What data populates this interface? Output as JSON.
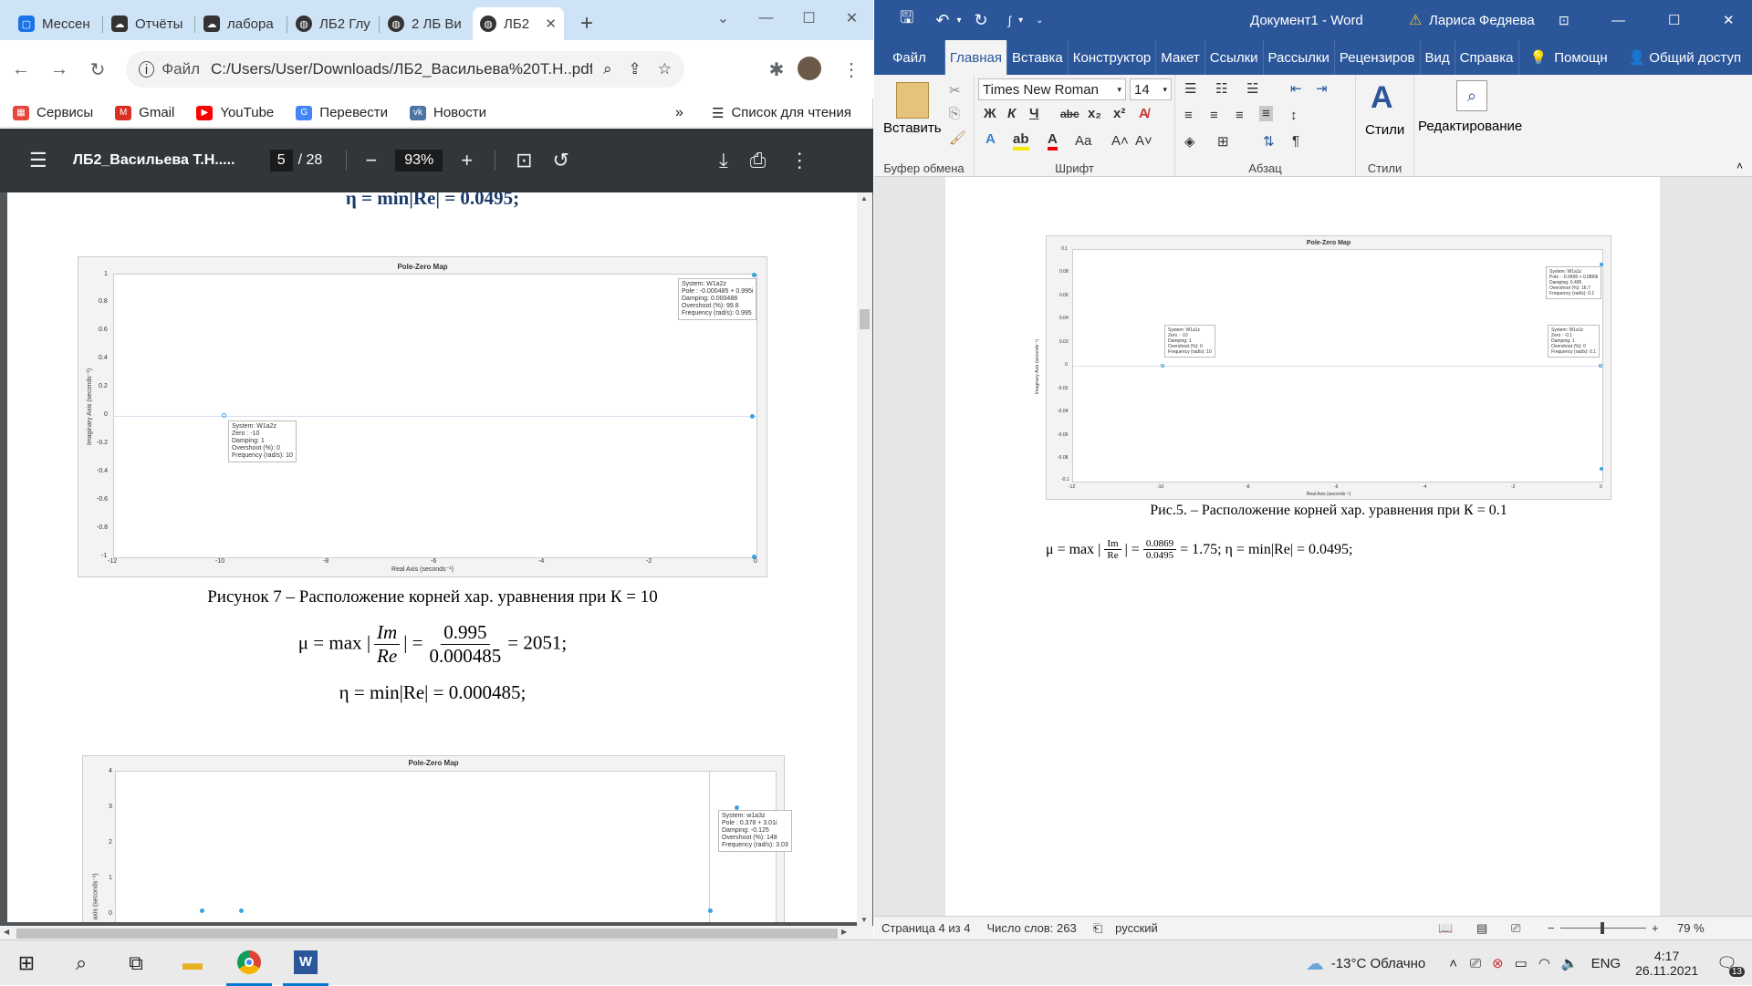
{
  "browser": {
    "tabs": [
      {
        "label": "Мессен",
        "icon": "messenger-icon",
        "color": "#1a73e8"
      },
      {
        "label": "Отчёты",
        "icon": "cloud-icon",
        "color": "#333"
      },
      {
        "label": "лабора",
        "icon": "cloud-icon",
        "color": "#333"
      },
      {
        "label": "ЛБ2 Глу",
        "icon": "globe-icon",
        "color": "#333"
      },
      {
        "label": "2 ЛБ Ви",
        "icon": "globe-icon",
        "color": "#333"
      },
      {
        "label": "ЛБ2",
        "icon": "globe-icon",
        "color": "#333"
      }
    ],
    "new_tab": "+",
    "address_prefix": "Файл",
    "address": "C:/Users/User/Downloads/ЛБ2_Васильева%20Т.Н..pdf",
    "bookmarks": [
      {
        "label": "Сервисы",
        "icon": "apps-icon",
        "color": "#e8453c"
      },
      {
        "label": "Gmail",
        "icon": "gmail-icon",
        "color": "#d93025"
      },
      {
        "label": "YouTube",
        "icon": "youtube-icon",
        "color": "#ff0000"
      },
      {
        "label": "Перевести",
        "icon": "translate-icon",
        "color": "#4285f4"
      },
      {
        "label": "Новости",
        "icon": "vk-icon",
        "color": "#4c75a3"
      }
    ],
    "bookmarks_more": "»",
    "reading_list": "Список для чтения"
  },
  "pdf": {
    "title": "ЛБ2_Васильева Т.Н.....",
    "page": "5",
    "page_total": "/ 28",
    "zoom": "93%",
    "eta_top": "η = min|Re| = 0.0495;",
    "plot1": {
      "title": "Pole-Zero Map",
      "xlabel": "Real Axis (seconds⁻¹)",
      "ylabel": "Imaginary Axis (seconds⁻¹)",
      "yticks": [
        "1",
        "0.8",
        "0.6",
        "0.4",
        "0.2",
        "0",
        "-0.2",
        "-0.4",
        "-0.6",
        "-0.8",
        "-1"
      ],
      "xticks": [
        "-12",
        "-10",
        "-8",
        "-6",
        "-4",
        "-2",
        "0"
      ],
      "tip1": [
        "System: W1a2z",
        "Pole : -0.000485 + 0.995i",
        "Damping: 0.000488",
        "Overshoot (%): 99.8",
        "Frequency (rad/s): 0.995"
      ],
      "tip2": [
        "System: W1a2z",
        "Zero : -10",
        "Damping: 1",
        "Overshoot (%): 0",
        "Frequency (rad/s): 10"
      ]
    },
    "caption7": "Рисунок 7 – Расположение корней хар. уравнения при К = 10",
    "mu_prefix": "μ = max",
    "mu_num_sym": "Im",
    "mu_den_sym": "Re",
    "mu_num": "0.995",
    "mu_den": "0.000485",
    "mu_result": "= 2051;",
    "eta": "η = min|Re| = 0.000485;",
    "plot2": {
      "title": "Pole-Zero Map",
      "ylabel": "axis (seconds⁻¹)",
      "yticks": [
        "4",
        "3",
        "2",
        "1",
        "0"
      ],
      "tip1": [
        "System: w1a3z",
        "Pole : 0.378 + 3.01i",
        "Damping: -0.125",
        "Overshoot (%): 148",
        "Frequency (rad/s): 3.03"
      ]
    }
  },
  "word": {
    "title": "Документ1 - Word",
    "user": "Лариса Федяева",
    "tabs": [
      "Файл",
      "Главная",
      "Вставка",
      "Конструктор",
      "Макет",
      "Ссылки",
      "Рассылки",
      "Рецензиров",
      "Вид",
      "Справка"
    ],
    "help": "Помощн",
    "share": "Общий доступ",
    "paste": "Вставить",
    "font": "Times New Roman",
    "size": "14",
    "styles": "Стили",
    "editing": "Редактирование",
    "groups": [
      "Буфер обмена",
      "Шрифт",
      "Абзац",
      "Стили"
    ],
    "plot": {
      "title": "Pole-Zero Map",
      "xlabel": "Real Axis (seconds⁻¹)",
      "ylabel": "Imaginary Axis (seconds⁻¹)",
      "yticks": [
        "0.1",
        "0.08",
        "0.06",
        "0.04",
        "0.02",
        "0",
        "-0.02",
        "-0.04",
        "-0.06",
        "-0.08",
        "-0.1"
      ],
      "xticks": [
        "-12",
        "-10",
        "-8",
        "-6",
        "-4",
        "-2",
        "0"
      ],
      "tip1": [
        "System: W1a1z",
        "Pole : -0.0495 + 0.0869i",
        "Damping: 0.495",
        "Overshoot (%): 16.7",
        "Frequency (rad/s): 0.1"
      ],
      "tip2": [
        "System: W1a1z",
        "Zero : -10",
        "Damping: 1",
        "Overshoot (%): 0",
        "Frequency (rad/s): 10"
      ],
      "tip3": [
        "System: W1a1z",
        "Zero : -0.1",
        "Damping: 1",
        "Overshoot (%): 0",
        "Frequency (rad/s): 0.1"
      ]
    },
    "caption": "Рис.5. – Расположение корней хар. уравнения при К = 0.1",
    "formula_prefix": "μ = max |",
    "f_num_sym": "Im",
    "f_den_sym": "Re",
    "f_num": "0.0869",
    "f_den": "0.0495",
    "formula_suffix": "= 1.75; η = min|Re| = 0.0495;",
    "status_page": "Страница 4 из 4",
    "status_words": "Число слов: 263",
    "status_lang": "русский",
    "zoom": "79 %"
  },
  "taskbar": {
    "weather": "-13°C  Облачно",
    "lang": "ENG",
    "time": "4:17",
    "date": "26.11.2021",
    "notif": "13"
  }
}
